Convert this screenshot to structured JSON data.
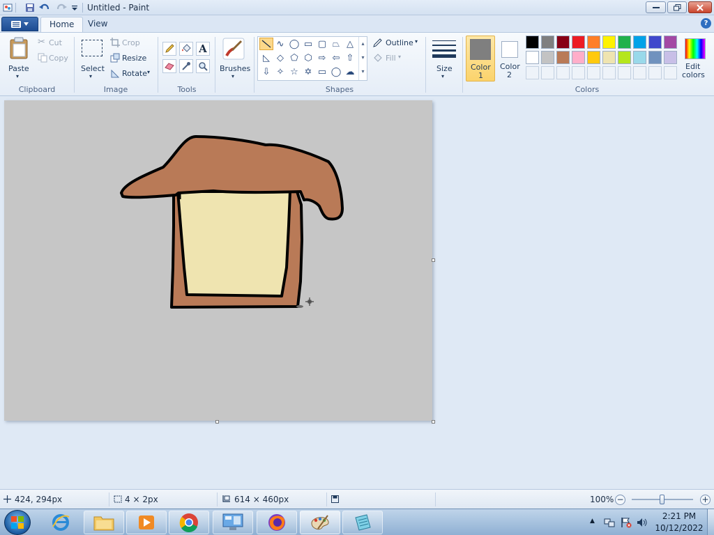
{
  "window": {
    "title": "Untitled - Paint"
  },
  "tabs": [
    {
      "label": "Home"
    },
    {
      "label": "View"
    }
  ],
  "ribbon": {
    "clipboard": {
      "paste": "Paste",
      "cut": "Cut",
      "copy": "Copy",
      "group": "Clipboard"
    },
    "image": {
      "select": "Select",
      "crop": "Crop",
      "resize": "Resize",
      "rotate": "Rotate",
      "group": "Image"
    },
    "tools": {
      "group": "Tools",
      "text_glyph": "A"
    },
    "brushes": {
      "label": "Brushes"
    },
    "shapes": {
      "outline": "Outline",
      "fill": "Fill",
      "group": "Shapes"
    },
    "size": {
      "label": "Size"
    },
    "colors": {
      "color1_label": "Color",
      "color1_num": "1",
      "color2_label": "Color",
      "color2_num": "2",
      "edit_label": "Edit",
      "edit_label2": "colors",
      "group": "Colors",
      "color1": "#7f7f7f",
      "color2": "#ffffff",
      "palette_row1": [
        "#000000",
        "#7f7f7f",
        "#880015",
        "#ed1c24",
        "#ff7f27",
        "#fff200",
        "#22b14c",
        "#00a2e8",
        "#3f48cc",
        "#a349a4"
      ],
      "palette_row2": [
        "#ffffff",
        "#c3c3c3",
        "#b97a57",
        "#ffaec9",
        "#ffc90e",
        "#efe4b0",
        "#b5e61d",
        "#99d9ea",
        "#7092be",
        "#c8bfe7"
      ]
    }
  },
  "drawing": {
    "roof_color": "#b97a57",
    "body_color": "#b97a57",
    "window_color": "#efe4b0",
    "outline_color": "#000000"
  },
  "status": {
    "cursor": "424, 294px",
    "selection": "4 × 2px",
    "canvas_size": "614 × 460px",
    "zoom": "100%"
  },
  "clock": {
    "time": "2:21 PM",
    "date": "10/12/2022"
  }
}
